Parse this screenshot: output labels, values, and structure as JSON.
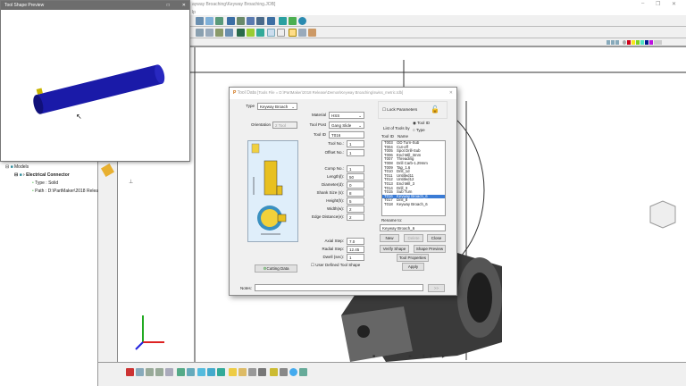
{
  "app": {
    "title_fragment": "ayway Broaching\\Keyway Broaching.JOB]",
    "menu_fragment": "lp"
  },
  "tree": {
    "models": "Models",
    "component": "Electrical Connector",
    "type": "Type : Solid",
    "path": "Path : D:\\PartMaker\\2018 Relea"
  },
  "preview": {
    "title": "Tool Shape Preview",
    "maximize": "□",
    "close": "✕"
  },
  "colors": {
    "palette": [
      "#d0021b",
      "#f8e71c",
      "#7ed321",
      "#50e3c2",
      "#00188f",
      "#bd10e0"
    ],
    "tool_body": "#1a1aa8",
    "dialog_accent": "#3a7bd5"
  },
  "dialog": {
    "title": "Tool Data",
    "subtitle": "[Tools File = D:\\PartMaker\\2018 Release\\Demos\\Keyway Broaching\\swiss_metric.tdb]",
    "close": "✕",
    "type_label": "Type",
    "type_value": "Keyway Broach",
    "orientation_label": "Orientation",
    "orientation_value": "2 Tool",
    "material_label": "Material",
    "material_value": "HSS",
    "toolpost_label": "Tool Post",
    "toolpost_value": "Gang Slide",
    "toolid_label": "Tool ID",
    "toolid_value": "T016",
    "fields": [
      {
        "label": "Tool No.:",
        "value": "1"
      },
      {
        "label": "Offset No.:",
        "value": "1"
      },
      {
        "label": "Comp No.:",
        "value": "1"
      },
      {
        "label": "Length(l):",
        "value": "50"
      },
      {
        "label": "Diameter(d):",
        "value": "0"
      },
      {
        "label": "Shank Size (s):",
        "value": "8"
      },
      {
        "label": "Height(h):",
        "value": "5"
      },
      {
        "label": "Width(w):",
        "value": "2"
      },
      {
        "label": "Edge Distance(e):",
        "value": "2"
      }
    ],
    "steps": [
      {
        "label": "Axial Step:",
        "value": "7.0"
      },
      {
        "label": "Radial Step:",
        "value": "12.45"
      },
      {
        "label": "Dwell (sec):",
        "value": "1"
      }
    ],
    "lock_parameters": "Lock Parameters",
    "list_by_label": "List of Tools by",
    "list_by_options": [
      "Tool ID",
      "Type"
    ],
    "list_headers": [
      "Tool ID",
      "Name"
    ],
    "tools": [
      [
        "T003",
        "OD Turn-Sub"
      ],
      [
        "T004",
        "Cut-off"
      ],
      [
        "T005",
        "Spot Drill-Sub"
      ],
      [
        "T006",
        "End Mill_3mm"
      ],
      [
        "T007",
        "Threading"
      ],
      [
        "T008",
        "Drill Carb-1.29mm"
      ],
      [
        "T009",
        "Tap_1.6"
      ],
      [
        "T010",
        "Drill_1d"
      ],
      [
        "T011",
        "Untitled11"
      ],
      [
        "T012",
        "Untitled12"
      ],
      [
        "T013",
        "End Mill_3"
      ],
      [
        "T014",
        "Drill_3"
      ],
      [
        "T015",
        "Sub Turn"
      ],
      [
        "T016",
        "Keyway Broach_6"
      ],
      [
        "T017",
        "Drill_8"
      ],
      [
        "T018",
        "Keyway Broach_6"
      ]
    ],
    "selected_tool": "T016",
    "rename_label": "Rename to:",
    "rename_value": "Keyway Broach_6",
    "buttons": {
      "new": "New",
      "delete": "Delete",
      "close": "Close",
      "verify": "Verify Shape",
      "shape_preview": "Shape Preview",
      "tool_properties": "Tool Properties",
      "apply": "Apply",
      "cutting_data": "Cutting Data",
      "notes_expand": ">>"
    },
    "user_defined": "User Defined Tool Shape",
    "notes_label": "Notes:",
    "notes_value": ""
  }
}
